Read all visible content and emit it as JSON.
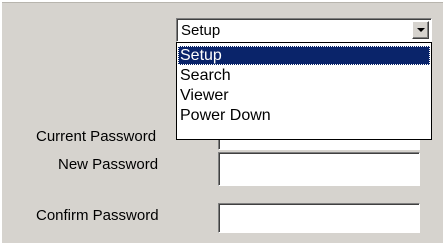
{
  "mode_select": {
    "selected": "Setup",
    "options": [
      "Setup",
      "Search",
      "Viewer",
      "Power Down"
    ]
  },
  "form": {
    "current_password_label": "Current Password",
    "new_password_label": "New Password",
    "confirm_password_label": "Confirm Password",
    "new_password_value": "",
    "confirm_password_value": ""
  }
}
